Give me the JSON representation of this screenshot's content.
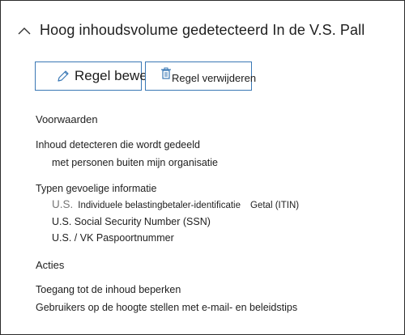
{
  "header": {
    "title": "Hoog inhoudsvolume gedetecteerd In de V.S. Pall",
    "collapse_icon": "chevron-up-icon"
  },
  "toolbar": {
    "edit_label": "Regel bewerken",
    "edit_icon": "pencil-icon",
    "delete_label": "Regel verwijderen",
    "delete_icon": "trash-icon",
    "accent": "#3a78b5"
  },
  "conditions": {
    "heading": "Voorwaarden",
    "detect_line": "Inhoud detecteren die wordt gedeeld",
    "detect_sub": "met personen buiten mijn organisatie",
    "types_heading": "Typen gevoelige informatie",
    "types": [
      {
        "prefix": "U.S.",
        "label": "Individuele belastingbetaler-identificatie",
        "suffix": "Getal (ITIN)"
      },
      {
        "label": "U.S. Social Security Number (SSN)"
      },
      {
        "label": "U.S. / VK Paspoortnummer"
      }
    ]
  },
  "actions": {
    "heading": "Acties",
    "items": [
      "Toegang tot de inhoud beperken",
      "Gebruikers op de hoogte stellen met e-mail- en beleidstips"
    ]
  }
}
